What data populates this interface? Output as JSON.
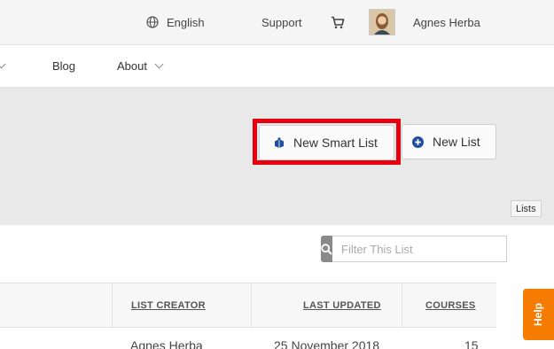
{
  "topbar": {
    "language": "English",
    "support": "Support",
    "user_name": "Agnes Herba"
  },
  "nav": {
    "blog": "Blog",
    "about": "About"
  },
  "actions": {
    "new_smart_list": "New Smart List",
    "new_list": "New List",
    "lists_tooltip": "Lists"
  },
  "filter": {
    "placeholder": "Filter This List"
  },
  "table": {
    "columns": {
      "list_creator": "LIST CREATOR",
      "last_updated": "LAST UPDATED",
      "courses": "COURSES"
    },
    "rows": [
      {
        "list_creator": "Agnes Herba",
        "last_updated": "25 November 2018",
        "courses": "15"
      }
    ]
  },
  "help": {
    "label": "Help"
  },
  "colors": {
    "highlight": "#e8000f",
    "help_tab": "#f57c00",
    "icon_blue": "#1f4e9c"
  }
}
